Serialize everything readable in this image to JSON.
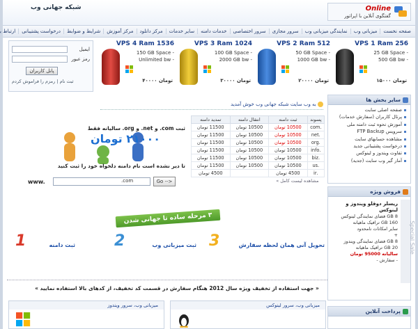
{
  "header": {
    "site_title": "شبکه جهانی وب",
    "online_label": "Online",
    "chat_label": "گفتگوی آنلاین با اپراتور"
  },
  "nav": {
    "items": [
      "صفحه نخست",
      "میزبانی وب",
      "نمایندگی میزبانی وب",
      "سرور مجازی",
      "سرور اختصاصی",
      "خدمات دامنه",
      "سایر خدمات",
      "مرکز دانلود",
      "مرکز آموزش",
      "شرایط و ضوابط",
      "درخواست پشتیبانی",
      "ارتباط با ما"
    ]
  },
  "login": {
    "email_label": "ایمیل",
    "password_label": "رمز عبور",
    "button_label": "پانل کاربران",
    "links": "ثبت نام | رمزم را فراموش کردم"
  },
  "vps": [
    {
      "title": "VPS 1 Ram 256",
      "space": "25 GB Space -",
      "bw": "500 GB bw -",
      "price": "۱۵۰۰۰ تومان",
      "color": "#2b2b2b"
    },
    {
      "title": "VPS 2 Ram 512",
      "space": "50 GB Space -",
      "bw": "1000 GB bw -",
      "price": "۲۰۰۰۰ تومان",
      "color": "#2f6fc0"
    },
    {
      "title": "VPS 3 Ram 1024",
      "space": "100 GB Space -",
      "bw": "2000 GB bw -",
      "price": "۳۰۰۰۰ تومان",
      "color": "#d9b322"
    },
    {
      "title": "VPS 4 Ram 1536",
      "space": "150 GB Space -",
      "bw": "Unlimited bw -",
      "price": "۴۰۰۰۰ تومان",
      "color": "#c8322b"
    }
  ],
  "welcome": "به وب سایت شبکه جهانی وب خوش آمدید",
  "domains": {
    "headers": [
      "پسوند",
      "ثبت دامنه",
      "انتقال دامنه",
      "تمدید دامنه"
    ],
    "rows": [
      [
        ".com",
        "10500 تومان",
        "10500 تومان",
        "11500 تومان"
      ],
      [
        ".net",
        "10500 تومان",
        "10500 تومان",
        "11500 تومان"
      ],
      [
        ".org",
        "10500 تومان",
        "10500 تومان",
        "11500 تومان"
      ],
      [
        ".info",
        "10500 تومان",
        "10500 تومان",
        "11500 تومان"
      ],
      [
        ".biz",
        "10500 تومان",
        "10500 تومان",
        "11500 تومان"
      ],
      [
        ".us",
        "10500 تومان",
        "10500 تومان",
        "11500 تومان"
      ],
      [
        ".ir",
        "4500 تومان",
        "",
        "4500 تومان"
      ]
    ],
    "footer": "مشاهده لیست کامل »"
  },
  "promo": {
    "line1": "ثبت com. و net. و org. سالیانه فقط",
    "price": "۲۱۰۰۰ تومان",
    "line2": "تا دیر نشده است نام دامنه دلخواه خود را ثبت کنید",
    "www": "www.",
    "ext": ".com",
    "go_label": "Go -->"
  },
  "steps": {
    "banner": "۳ مرحله ساده تا جهانی شدن",
    "step1": "ثبت دامنه",
    "step2": "ثبت میزبانی وب",
    "step3": "تحویل آنی همان لحظه سفارش"
  },
  "notice": "« جهت استفاده از تخفیف ویژه سال 2012 هنگام سفارش در قسمت کد تخفیف، از کدهای بالا استفاده نمایید »",
  "side": {
    "title": "سایر بخش ها",
    "items": [
      "صفحه اصلی سایت",
      "پرتال کاربران (سفارش خدمات)",
      "آموزش نحوه ثبت دامنه ملی",
      "سرویس FTP Backup",
      "مشاهده حسابهای سایت",
      "درخواست پشتیبانی جدید",
      "تفاوت ویندوز و لینوکس",
      "آمار گیر وب سایت (جدید)"
    ]
  },
  "special": {
    "title": "فروش ویژه",
    "label": "Special Sale",
    "heading": "ریسلر دوقلو ویندوز و لینوکس",
    "lines": [
      "8 GB فضای نمایندگی لینوکس",
      "160 GB ترافیک ماهیانه",
      "سایر امکانات نامحدود",
      "+",
      "8 GB فضای نمایندگی ویندوز",
      "20 GB ترافیک ماهیانه"
    ],
    "price": "سالیانه 95000 تومان",
    "order": "- سفارش -"
  },
  "bottom": {
    "linux": "میزبانی وب، سرور لینوکس",
    "windows": "میزبانی وب، سرور ویندوز",
    "online": "پرداخت آنلاین"
  }
}
